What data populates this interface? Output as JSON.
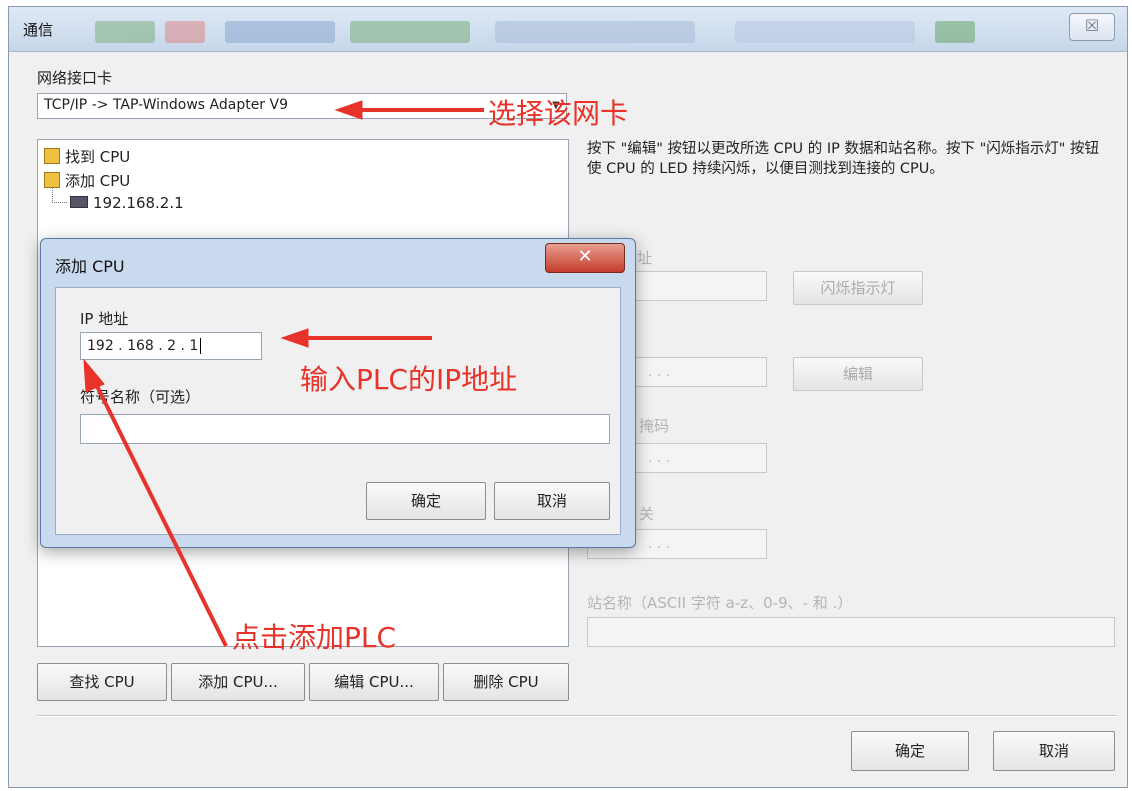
{
  "window": {
    "title": "通信",
    "close_symbol": "☒"
  },
  "main": {
    "nic_label": "网络接口卡",
    "nic_value": "TCP/IP -> TAP-Windows Adapter V9",
    "tree": {
      "find_cpu": "找到 CPU",
      "add_cpu": "添加 CPU",
      "ip_entry": "192.168.2.1"
    },
    "info_text": "按下 \"编辑\" 按钮以更改所选 CPU 的 IP 数据和站名称。按下 \"闪烁指示灯\" 按钮使 CPU 的 LED 持续闪烁，以便目测找到连接的 CPU。",
    "partial_labels": {
      "address": "址",
      "subnet": "掩码",
      "gateway": "关"
    },
    "blink_button": "闪烁指示灯",
    "edit_button": "编辑",
    "ip_dots": ".     .     .",
    "station_label": "站名称（ASCII 字符 a-z、0-9、- 和 .）",
    "buttons": {
      "find": "查找 CPU",
      "add": "添加 CPU...",
      "edit": "编辑 CPU...",
      "delete": "删除 CPU"
    },
    "ok": "确定",
    "cancel": "取消"
  },
  "dialog": {
    "title": "添加 CPU",
    "close_symbol": "✕",
    "ip_label": "IP 地址",
    "ip_value": "192 . 168 .  2  .  1",
    "name_label": "符号名称（可选）",
    "name_value": "",
    "ok": "确定",
    "cancel": "取消"
  },
  "annotations": {
    "select_nic": "选择该网卡",
    "enter_ip": "输入PLC的IP地址",
    "click_add": "点击添加PLC",
    "color": "#e8332a"
  }
}
